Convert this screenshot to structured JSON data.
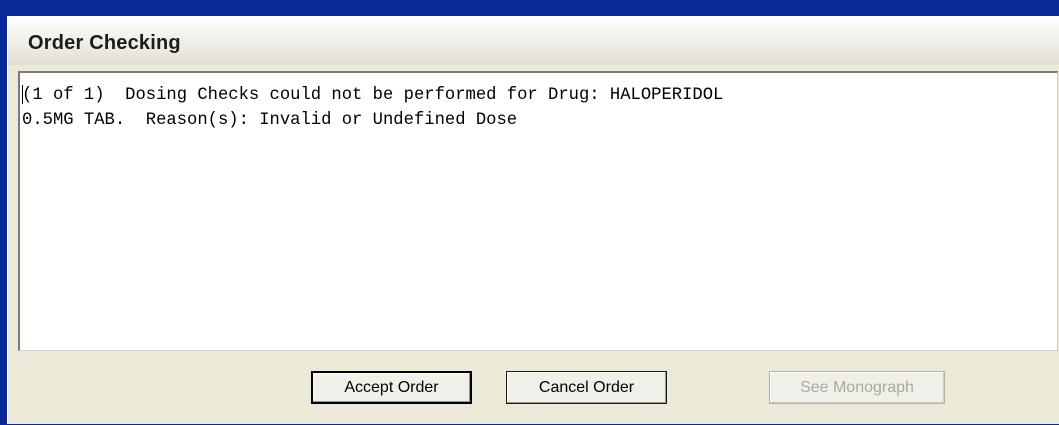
{
  "window": {
    "title": "Order Checking"
  },
  "message": {
    "text": "(1 of 1)  Dosing Checks could not be performed for Drug: HALOPERIDOL\n0.5MG TAB.  Reason(s): Invalid or Undefined Dose"
  },
  "buttons": {
    "accept_label": "Accept Order",
    "cancel_label": "Cancel Order",
    "monograph_label": "See Monograph",
    "monograph_enabled": false
  },
  "colors": {
    "desktop_background": "#0a2a9a",
    "dialog_background": "#ece9d8",
    "disabled_text": "#aca899"
  }
}
